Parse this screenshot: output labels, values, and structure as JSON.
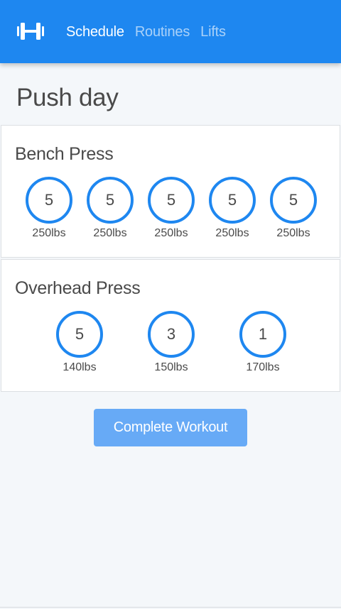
{
  "nav": {
    "logo_icon": "dumbbell-icon",
    "links": [
      {
        "label": "Schedule",
        "active": true
      },
      {
        "label": "Routines",
        "active": false
      },
      {
        "label": "Lifts",
        "active": false
      }
    ]
  },
  "page": {
    "title": "Push day"
  },
  "exercises": [
    {
      "name": "Bench Press",
      "sets": [
        {
          "reps": "5",
          "weight": "250lbs"
        },
        {
          "reps": "5",
          "weight": "250lbs"
        },
        {
          "reps": "5",
          "weight": "250lbs"
        },
        {
          "reps": "5",
          "weight": "250lbs"
        },
        {
          "reps": "5",
          "weight": "250lbs"
        }
      ]
    },
    {
      "name": "Overhead Press",
      "sets": [
        {
          "reps": "5",
          "weight": "140lbs"
        },
        {
          "reps": "3",
          "weight": "150lbs"
        },
        {
          "reps": "1",
          "weight": "170lbs"
        }
      ]
    }
  ],
  "actions": {
    "complete_label": "Complete Workout"
  },
  "colors": {
    "primary": "#1e87f0",
    "button": "#67aaf6",
    "background": "#f4f7fa"
  }
}
